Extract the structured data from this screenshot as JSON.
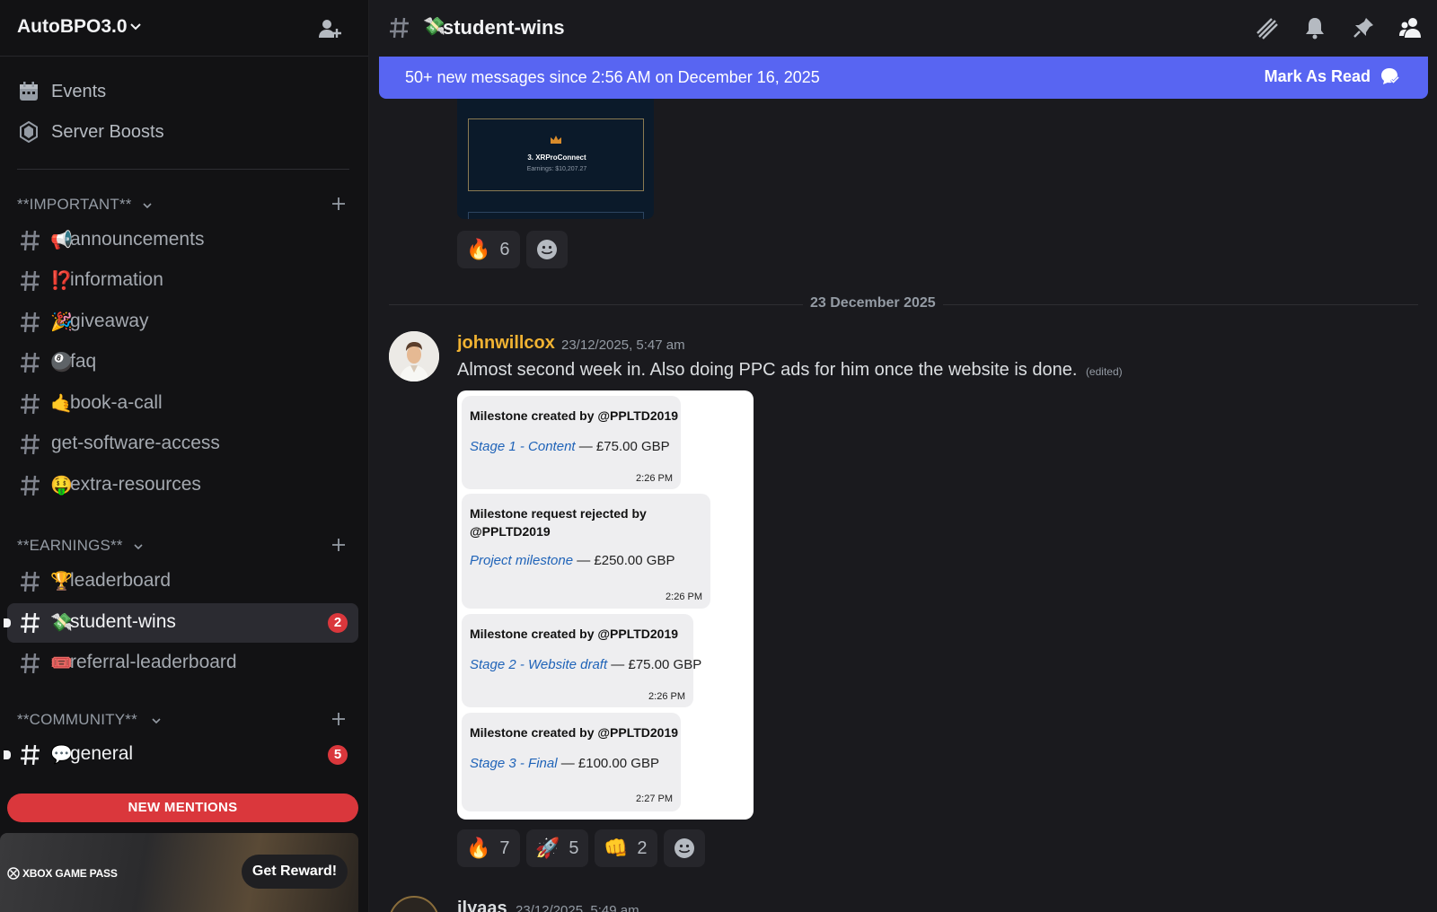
{
  "server": {
    "name": "AutoBPO3.0"
  },
  "sidebar": {
    "utilities": [
      {
        "label": "Events",
        "icon": "calendar-icon"
      },
      {
        "label": "Server Boosts",
        "icon": "boost-icon"
      }
    ],
    "categories": [
      {
        "label": "**IMPORTANT**"
      },
      {
        "label": "**EARNINGS**"
      },
      {
        "label": "**COMMUNITY**"
      }
    ],
    "channels": [
      {
        "emoji": "📢",
        "label": "announcements"
      },
      {
        "emoji": "⁉️",
        "label": "information"
      },
      {
        "emoji": "🎉",
        "label": "giveaway"
      },
      {
        "emoji": "🎱",
        "label": "faq"
      },
      {
        "emoji": "🤙",
        "label": "book-a-call"
      },
      {
        "emoji": "",
        "label": "get-software-access"
      },
      {
        "emoji": "🤑",
        "label": "extra-resources"
      },
      {
        "emoji": "🏆",
        "label": "leaderboard"
      },
      {
        "emoji": "💸",
        "label": "student-wins",
        "badge": "2",
        "active": true
      },
      {
        "emoji": "🎟️",
        "label": "referral-leaderboard"
      },
      {
        "emoji": "💬",
        "label": "general",
        "badge": "5",
        "unread": true
      }
    ],
    "new_mentions": "NEW MENTIONS",
    "promo": {
      "brand": "XBOX GAME PASS",
      "button": "Get Reward!"
    }
  },
  "channel_header": {
    "emoji": "💸",
    "title": "student-wins"
  },
  "banner": {
    "text": "50+ new messages since 2:56 AM on December 16, 2025",
    "action": "Mark As Read"
  },
  "prev_image": {
    "name": "3. XRProConnect",
    "earnings": "Earnings: $10,207.27"
  },
  "prev_reactions": [
    {
      "emoji": "🔥",
      "count": "6"
    }
  ],
  "date_divider": "23 December 2025",
  "message": {
    "author": "johnwillcox",
    "timestamp": "23/12/2025, 5:47 am",
    "text": "Almost second week in. Also doing PPC ads for him once the website is done.",
    "edited": "(edited)"
  },
  "attachment_cards": [
    {
      "title": "Milestone created by @PPLTD2019",
      "link": "Stage 1 - Content",
      "amount": " — £75.00 GBP",
      "time": "2:26 PM"
    },
    {
      "title": "Milestone request rejected by @PPLTD2019",
      "link": "Project milestone",
      "amount": " — £250.00 GBP",
      "time": "2:26 PM"
    },
    {
      "title": "Milestone created by @PPLTD2019",
      "link": "Stage 2 - Website draft",
      "amount": " — £75.00 GBP",
      "time": "2:26 PM"
    },
    {
      "title": "Milestone created by @PPLTD2019",
      "link": "Stage 3 - Final",
      "amount": " — £100.00 GBP",
      "time": "2:27 PM"
    }
  ],
  "reactions": [
    {
      "emoji": "🔥",
      "count": "7"
    },
    {
      "emoji": "🚀",
      "count": "5"
    },
    {
      "emoji": "👊",
      "count": "2"
    }
  ],
  "next_message": {
    "author": "ilyaas",
    "timestamp": "23/12/2025, 5:49 am"
  },
  "colors": {
    "accent": "#5865f2",
    "badge": "#da373c",
    "username": "#f0b232",
    "link": "#1f63b8"
  }
}
